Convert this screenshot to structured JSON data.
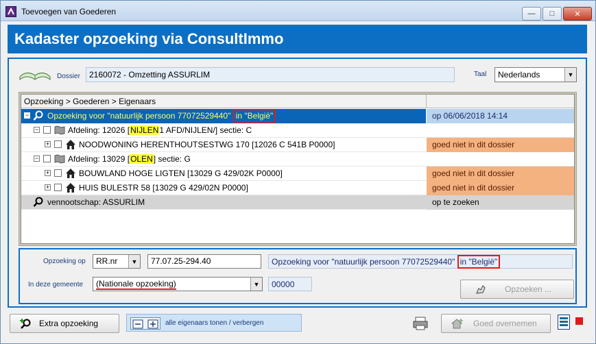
{
  "window": {
    "title": "Toevoegen van Goederen"
  },
  "header": {
    "title": "Kadaster opzoeking via ConsultImmo"
  },
  "dossier": {
    "label": "Dossier",
    "value": "2160072 - Omzetting ASSURLIM"
  },
  "taal": {
    "label": "Taal",
    "value": "Nederlands"
  },
  "tree": {
    "column_header": "Opzoeking > Goederen > Eigenaars",
    "rows": [
      {
        "text": "Opzoeking voor \"natuurlijk persoon 77072529440\"",
        "suffix": "in \"België\"",
        "status": "op 06/06/2018 14:14"
      },
      {
        "prefix": "Afdeling: 12026 [",
        "highlight": "NIJLEN",
        "rest": "1 AFD/NIJLEN/]  sectie: C",
        "status": ""
      },
      {
        "text": "NOODWONING   HERENTHOUTSESTWG 170       [12026 C 541B P0000]",
        "status": "goed niet in dit dossier"
      },
      {
        "prefix": "Afdeling: 13029 [",
        "highlight": "OLEN",
        "rest": "]  sectie: G",
        "status": ""
      },
      {
        "text": "BOUWLAND   HOGE LIGTEN         [13029 G 429/02K P0000]",
        "status": "goed niet in dit dossier"
      },
      {
        "text": "HUIS   BULESTR 58          [13029 G 429/02N P0000]",
        "status": "goed niet in dit dossier"
      },
      {
        "text": "vennootschap: ASSURLIM",
        "status": "op te zoeken"
      }
    ]
  },
  "search": {
    "opzoeking_label": "Opzoeking op",
    "type_value": "RR.nr",
    "number_value": "77.07.25-294.40",
    "description": "Opzoeking voor \"natuurlijk persoon 77072529440\"",
    "description_suffix": "in \"België\"",
    "gemeente_label": "In deze gemeente",
    "gemeente_value": "(Nationale opzoeking)",
    "code_value": "00000",
    "search_button": "Opzoeken ..."
  },
  "footer": {
    "extra_button": "Extra opzoeking",
    "toggle_text": "alle eigenaars tonen / verbergen",
    "accept_button": "Goed overnemen"
  }
}
